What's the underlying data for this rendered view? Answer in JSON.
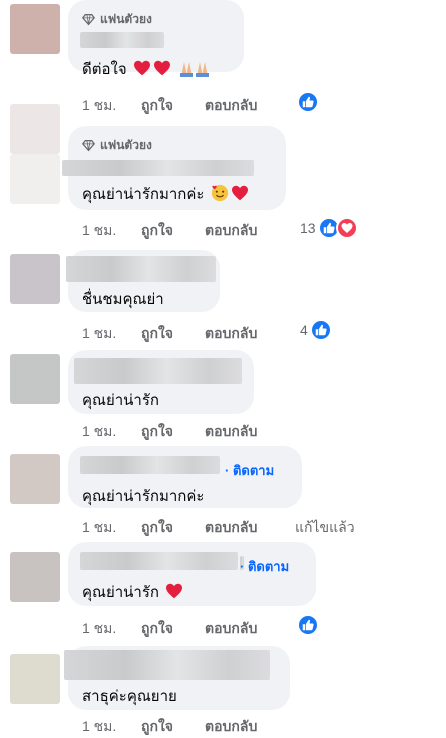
{
  "comments": [
    {
      "badge": "แฟนตัวยง",
      "text": "ดีต่อใจ",
      "time": "1 ชม.",
      "like": "ถูกใจ",
      "reply": "ตอบกลับ",
      "reaction_count": "",
      "avatar_color": "#cdb1aa"
    },
    {
      "badge": "แฟนตัวยง",
      "text": "คุณย่าน่ารักมากค่ะ",
      "time": "1 ชม.",
      "like": "ถูกใจ",
      "reply": "ตอบกลับ",
      "reaction_count": "13",
      "avatar_color": "#ece7e6"
    },
    {
      "text": "ชื่นชมคุณย่า",
      "time": "1 ชม.",
      "like": "ถูกใจ",
      "reply": "ตอบกลับ",
      "reaction_count": "4",
      "avatar_color": "#c9c4c9"
    },
    {
      "text": "คุณย่าน่ารัก",
      "time": "1 ชม.",
      "like": "ถูกใจ",
      "reply": "ตอบกลับ",
      "reaction_count": "",
      "avatar_color": "#c5c7c6"
    },
    {
      "follow": "· ติดตาม",
      "text": "คุณย่าน่ารักมากค่ะ",
      "time": "1 ชม.",
      "like": "ถูกใจ",
      "reply": "ตอบกลับ",
      "edited": "แก้ไขแล้ว",
      "avatar_color": "#d3c9c4"
    },
    {
      "follow": "· ติดตาม",
      "text": "คุณย่าน่ารัก",
      "time": "1 ชม.",
      "like": "ถูกใจ",
      "reply": "ตอบกลับ",
      "reaction_count": "",
      "avatar_color": "#c8c3c0"
    },
    {
      "text": "สาธุค่ะคุณยาย",
      "time": "1 ชม.",
      "like": "ถูกใจ",
      "reply": "ตอบกลับ",
      "avatar_color": "#dedccf"
    }
  ],
  "colors": {
    "bubble": "#f0f2f5",
    "link_blue": "#0866ff",
    "like_blue": "#1877f2",
    "love_red": "#f33e58",
    "meta_gray": "#65676b"
  },
  "icons": [
    "diamond-icon",
    "heart-icon",
    "pray-icon",
    "smiling-hearts-icon",
    "like-icon",
    "love-icon"
  ]
}
